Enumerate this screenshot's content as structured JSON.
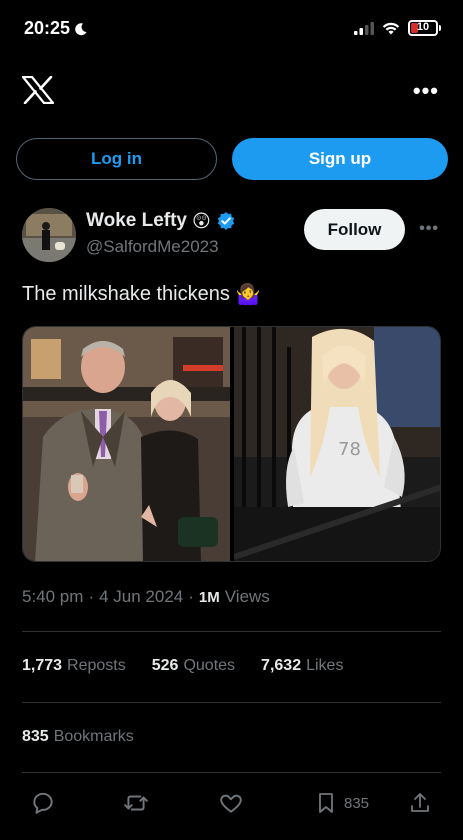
{
  "status_bar": {
    "time": "20:25",
    "battery": "10"
  },
  "auth": {
    "login_label": "Log in",
    "signup_label": "Sign up"
  },
  "author": {
    "name": "Woke Lefty",
    "handle": "@SalfordMe2023",
    "emoji": "😲",
    "follow_label": "Follow"
  },
  "tweet": {
    "text": "The milkshake thickens",
    "emoji": "🤷‍♀️"
  },
  "meta": {
    "time": "5:40 pm",
    "date": "4 Jun 2024",
    "views_count": "1M",
    "views_label": "Views"
  },
  "stats": [
    {
      "num": "1,773",
      "label": "Reposts"
    },
    {
      "num": "526",
      "label": "Quotes"
    },
    {
      "num": "7,632",
      "label": "Likes"
    }
  ],
  "bookmarks": {
    "num": "835",
    "label": "Bookmarks"
  },
  "actions": {
    "bookmark_count": "835"
  },
  "colors": {
    "accent": "#1d9bf0",
    "background": "#000000",
    "muted": "#71767b",
    "divider": "#2f3336"
  }
}
